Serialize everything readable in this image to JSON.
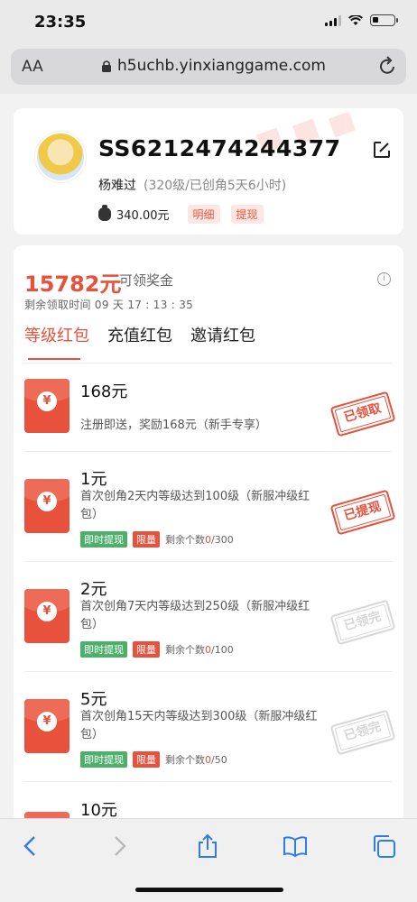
{
  "status_bar": {
    "time": "23:35"
  },
  "browser": {
    "aa_label": "AA",
    "url": "h5uchb.yinxianggame.com"
  },
  "profile": {
    "user_id": "SS6212474244377",
    "nickname": "杨难过",
    "level_info": "(320级/已创角5天6小时)",
    "balance": "340.00元",
    "detail_label": "明细",
    "withdraw_label": "提现"
  },
  "reward": {
    "amount": "15782元",
    "amount_label": "可领奖金",
    "countdown": "剩余领取时间 09 天 17 : 13 : 35",
    "tabs": [
      "等级红包",
      "充值红包",
      "邀请红包"
    ],
    "items": [
      {
        "title": "168元",
        "desc": "注册即送，奖励168元（新手专享）",
        "stamp": "已领取"
      },
      {
        "title": "1元",
        "desc": "首次创角2天内等级达到100级（新服冲级红包）",
        "badge1": "即时提现",
        "badge2": "限量",
        "remain_label": "剩余个数",
        "remain_used": "0",
        "remain_total": "/300",
        "stamp": "已提现"
      },
      {
        "title": "2元",
        "desc": "首次创角7天内等级达到250级（新服冲级红包）",
        "badge1": "即时提现",
        "badge2": "限量",
        "remain_label": "剩余个数",
        "remain_used": "0",
        "remain_total": "/100",
        "stamp": "已领完"
      },
      {
        "title": "5元",
        "desc": "首次创角15天内等级达到300级（新服冲级红包）",
        "badge1": "即时提现",
        "badge2": "限量",
        "remain_label": "剩余个数",
        "remain_used": "0",
        "remain_total": "/50",
        "stamp": "已领完"
      },
      {
        "title": "10元"
      }
    ]
  },
  "colors": {
    "accent": "#e8513c",
    "green": "#4caf6a",
    "ios_blue": "#2f7de1"
  },
  "icons": [
    "signal-icon",
    "wifi-icon",
    "battery-icon",
    "lock-icon",
    "reload-icon",
    "edit-icon",
    "money-bag-icon",
    "info-icon",
    "back-icon",
    "forward-icon",
    "share-icon",
    "bookmarks-icon",
    "tabs-icon"
  ]
}
